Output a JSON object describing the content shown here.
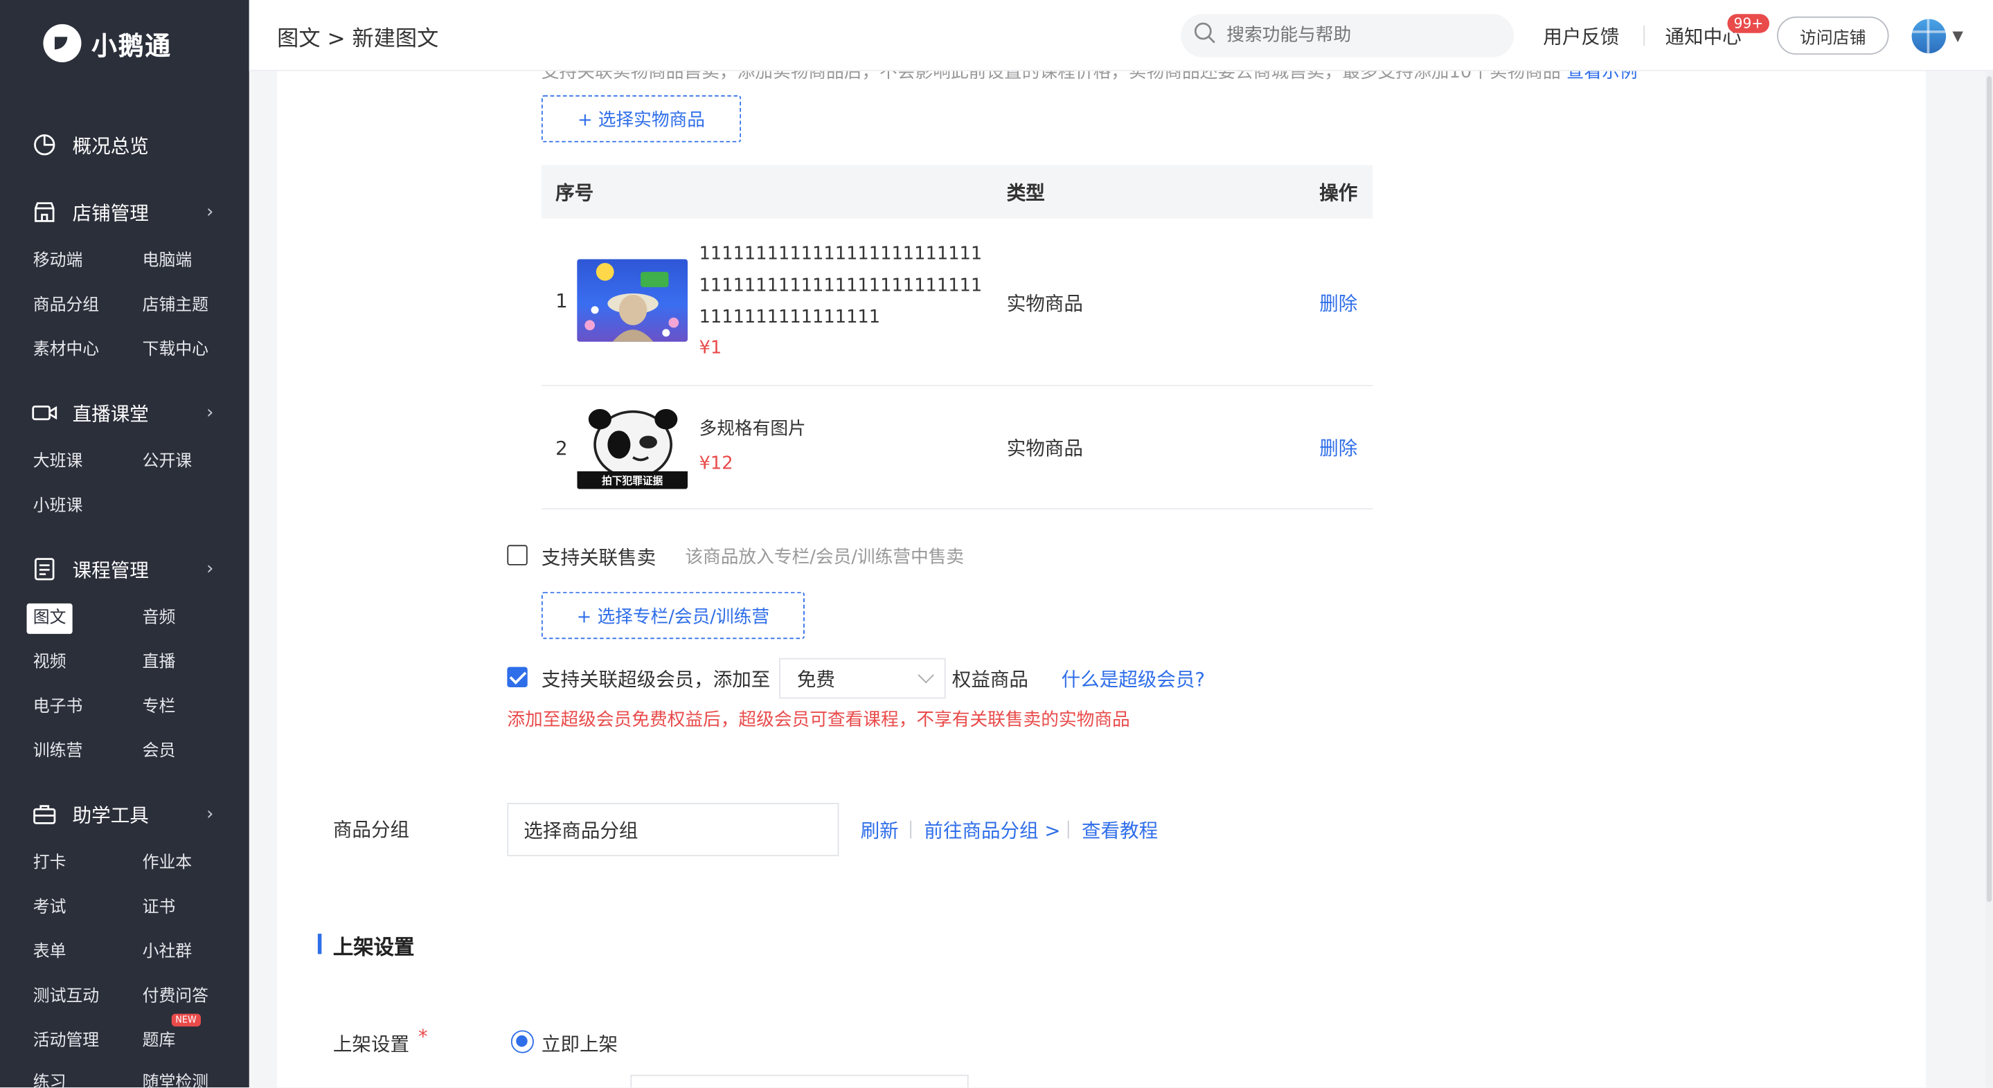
{
  "app": {
    "logo_text": "小鹅通"
  },
  "sidebar": {
    "groups": [
      {
        "title": "概况总览"
      },
      {
        "title": "店铺管理",
        "items": [
          "移动端",
          "电脑端",
          "商品分组",
          "店铺主题",
          "素材中心",
          "下载中心"
        ]
      },
      {
        "title": "直播课堂",
        "items": [
          "大班课",
          "公开课",
          "小班课"
        ]
      },
      {
        "title": "课程管理",
        "items": [
          "图文",
          "音频",
          "视频",
          "直播",
          "电子书",
          "专栏",
          "训练营",
          "会员"
        ]
      },
      {
        "title": "助学工具",
        "items": [
          "打卡",
          "作业本",
          "考试",
          "证书",
          "表单",
          "小社群",
          "测试互动",
          "付费问答",
          "活动管理",
          "题库",
          "练习",
          "随堂检测"
        ]
      }
    ],
    "new_badge": "NEW"
  },
  "header": {
    "breadcrumb": "图文 > 新建图文",
    "search_placeholder": "搜索功能与帮助",
    "feedback": "用户反馈",
    "notifications": "通知中心",
    "notif_count": "99+",
    "visit_store": "访问店铺"
  },
  "physical_goods": {
    "cut_text": "支持关联实物商品售卖，添加实物商品后，不会影响此前设置的课程价格，实物商品还要去商城售卖，最多支持添加10个实物商品",
    "cut_link": "查看示例",
    "select_button": "+ 选择实物商品",
    "columns": [
      "序号",
      "类型",
      "操作"
    ],
    "rows": [
      {
        "index": "1",
        "name": "111111111111111111111111111111111111111111111111111111111111111111",
        "price": "¥1",
        "type": "实物商品",
        "action": "删除"
      },
      {
        "index": "2",
        "name": "多规格有图片",
        "price": "¥12",
        "type": "实物商品",
        "action": "删除",
        "thumb_caption": "拍下犯罪证据"
      }
    ]
  },
  "related_sale": {
    "label": "支持关联售卖",
    "hint": "该商品放入专栏/会员/训练营中售卖",
    "select_button": "+ 选择专栏/会员/训练营"
  },
  "super_member": {
    "label": "支持关联超级会员，添加至",
    "select_value": "免费",
    "suffix": "权益商品",
    "help_link": "什么是超级会员?",
    "warning": "添加至超级会员免费权益后，超级会员可查看课程，不享有关联售卖的实物商品"
  },
  "goods_group": {
    "label": "商品分组",
    "placeholder": "选择商品分组",
    "refresh": "刷新",
    "goto": "前往商品分组 >",
    "tutorial": "查看教程"
  },
  "listing": {
    "section_title": "上架设置",
    "label": "上架设置",
    "required": "*",
    "option": "立即上架"
  },
  "colors": {
    "accent": "#2f6ee9",
    "danger": "#e94b4b",
    "sidebar": "#2b2f3a"
  }
}
